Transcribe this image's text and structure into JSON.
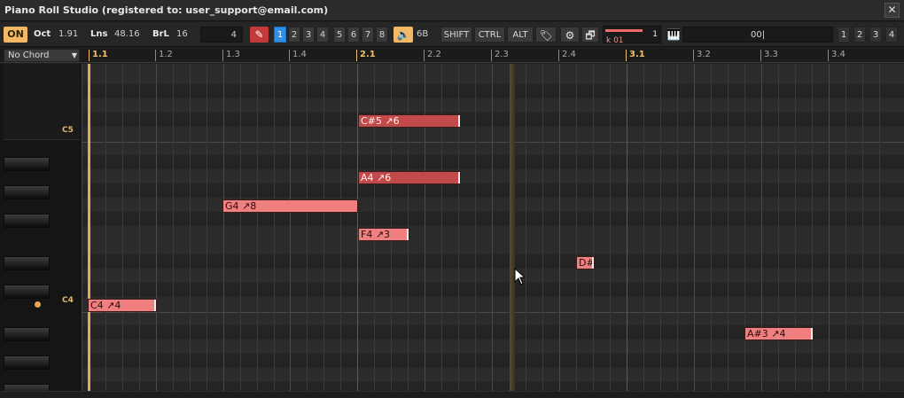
{
  "window": {
    "title": "Piano Roll Studio  (registered to: user_support@email.com)",
    "close": "✕"
  },
  "toolbar": {
    "on": "ON",
    "oct_label": "Oct",
    "oct_value": "1.91",
    "lns_label": "Lns",
    "lns_value": "48.16",
    "brl_label": "BrL",
    "brl_value": "16",
    "field_value": "4",
    "pencil": "✎",
    "channels_a": [
      "1",
      "2",
      "3",
      "4"
    ],
    "channels_b": [
      "5",
      "6",
      "7",
      "8"
    ],
    "active_channel": "1",
    "speaker": "🔈",
    "sixb": "6B",
    "shift": "SHIFT",
    "ctrl": "CTRL",
    "alt": "ALT",
    "tag_icon": "🏷",
    "gear_icon": "⚙",
    "window_icon": "🗗",
    "velocity_text": "k 01",
    "velocity_num": "1",
    "velocity_level": 0.72,
    "piano_icon": "🎹",
    "chord_value": "00|",
    "mini": [
      "1",
      "2",
      "3",
      "4"
    ]
  },
  "ruler": {
    "chord_select": "No Chord",
    "ticks": [
      "1.1",
      "1.2",
      "1.3",
      "1.4",
      "2.1",
      "2.2",
      "2.3",
      "2.4",
      "3.1",
      "3.2",
      "3.3",
      "3.4"
    ]
  },
  "keyboard": {
    "labels": [
      "C5",
      "C4"
    ]
  },
  "notes": [
    {
      "label": "C#5 ↗6",
      "style": "sel"
    },
    {
      "label": "A4 ↗6",
      "style": "sel"
    },
    {
      "label": "G4 ↗8",
      "style": "norm"
    },
    {
      "label": "F4 ↗3",
      "style": "norm"
    },
    {
      "label": "D#",
      "style": "norm"
    },
    {
      "label": "C4 ↗4",
      "style": "norm"
    },
    {
      "label": "A#3 ↗4",
      "style": "norm"
    }
  ],
  "colors": {
    "accent": "#f2b866",
    "selected_note": "#c24a4a",
    "note": "#f08080",
    "active_channel": "#2f8fe6"
  }
}
